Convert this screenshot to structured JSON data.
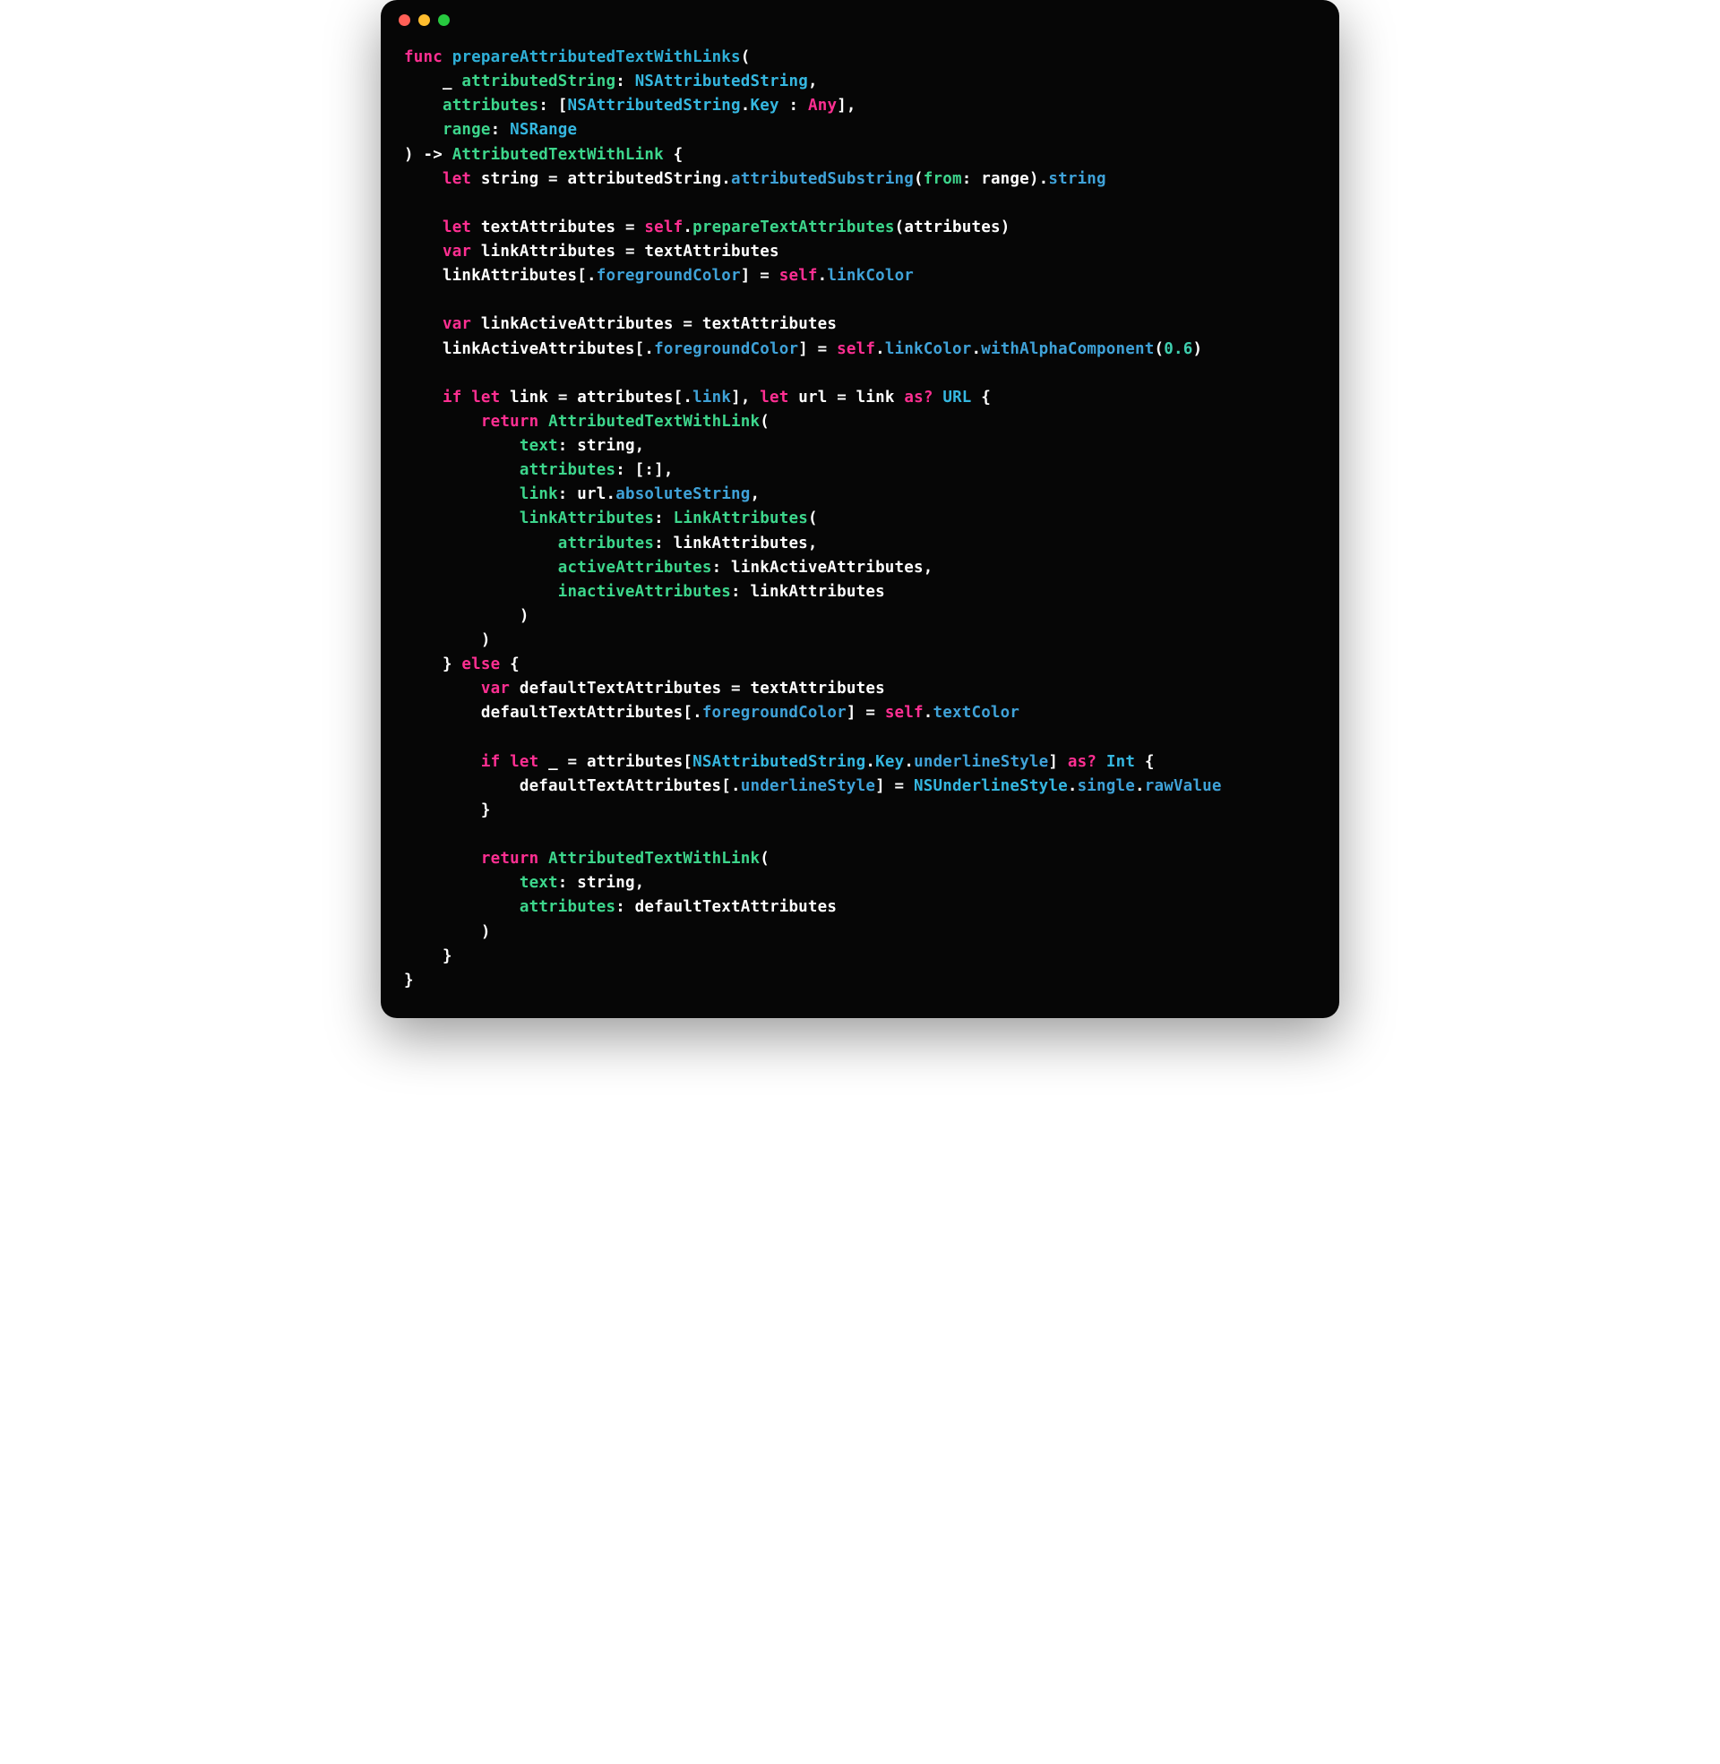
{
  "window": {
    "traffic_lights": {
      "close": "close",
      "minimize": "minimize",
      "zoom": "zoom"
    }
  },
  "code": {
    "l01": {
      "a": "func",
      "b": " ",
      "c": "prepareAttributedTextWithLinks",
      "d": "("
    },
    "l02": {
      "a": "    _ ",
      "b": "attributedString",
      "c": ": ",
      "d": "NSAttributedString",
      "e": ","
    },
    "l03": {
      "a": "    ",
      "b": "attributes",
      "c": ": [",
      "d": "NSAttributedString",
      "e": ".",
      "f": "Key",
      "g": " : ",
      "h": "Any",
      "i": "],"
    },
    "l04": {
      "a": "    ",
      "b": "range",
      "c": ": ",
      "d": "NSRange"
    },
    "l05": {
      "a": ") -> ",
      "b": "AttributedTextWithLink",
      "c": " {"
    },
    "l06": {
      "a": "    ",
      "b": "let",
      "c": " string = attributedString.",
      "d": "attributedSubstring",
      "e": "(",
      "f": "from",
      "g": ": range).",
      "h": "string"
    },
    "l07": "",
    "l08": {
      "a": "    ",
      "b": "let",
      "c": " textAttributes = ",
      "d": "self",
      "e": ".",
      "f": "prepareTextAttributes",
      "g": "(attributes)"
    },
    "l09": {
      "a": "    ",
      "b": "var",
      "c": " linkAttributes = textAttributes"
    },
    "l10": {
      "a": "    linkAttributes[.",
      "b": "foregroundColor",
      "c": "] = ",
      "d": "self",
      "e": ".",
      "f": "linkColor"
    },
    "l11": "",
    "l12": {
      "a": "    ",
      "b": "var",
      "c": " linkActiveAttributes = textAttributes"
    },
    "l13": {
      "a": "    linkActiveAttributes[.",
      "b": "foregroundColor",
      "c": "] = ",
      "d": "self",
      "e": ".",
      "f": "linkColor",
      "g": ".",
      "h": "withAlphaComponent",
      "i": "(",
      "j": "0.6",
      "k": ")"
    },
    "l14": "",
    "l15": {
      "a": "    ",
      "b": "if",
      "c": " ",
      "d": "let",
      "e": " link = attributes[.",
      "f": "link",
      "g": "], ",
      "h": "let",
      "i": " url = link ",
      "j": "as?",
      "k": " ",
      "l": "URL",
      "m": " {"
    },
    "l16": {
      "a": "        ",
      "b": "return",
      "c": " ",
      "d": "AttributedTextWithLink",
      "e": "("
    },
    "l17": {
      "a": "            ",
      "b": "text",
      "c": ": string,"
    },
    "l18": {
      "a": "            ",
      "b": "attributes",
      "c": ": [:],"
    },
    "l19": {
      "a": "            ",
      "b": "link",
      "c": ": url.",
      "d": "absoluteString",
      "e": ","
    },
    "l20": {
      "a": "            ",
      "b": "linkAttributes",
      "c": ": ",
      "d": "LinkAttributes",
      "e": "("
    },
    "l21": {
      "a": "                ",
      "b": "attributes",
      "c": ": linkAttributes,"
    },
    "l22": {
      "a": "                ",
      "b": "activeAttributes",
      "c": ": linkActiveAttributes,"
    },
    "l23": {
      "a": "                ",
      "b": "inactiveAttributes",
      "c": ": linkAttributes"
    },
    "l24": {
      "a": "            )"
    },
    "l25": {
      "a": "        )"
    },
    "l26": {
      "a": "    } ",
      "b": "else",
      "c": " {"
    },
    "l27": {
      "a": "        ",
      "b": "var",
      "c": " defaultTextAttributes = textAttributes"
    },
    "l28": {
      "a": "        defaultTextAttributes[.",
      "b": "foregroundColor",
      "c": "] = ",
      "d": "self",
      "e": ".",
      "f": "textColor"
    },
    "l29": "",
    "l30": {
      "a": "        ",
      "b": "if",
      "c": " ",
      "d": "let",
      "e": " _ = attributes[",
      "f": "NSAttributedString",
      "g": ".",
      "h": "Key",
      "i": ".",
      "j": "underlineStyle",
      "k": "] ",
      "l": "as?",
      "m": " ",
      "n": "Int",
      "o": " {"
    },
    "l31": {
      "a": "            defaultTextAttributes[.",
      "b": "underlineStyle",
      "c": "] = ",
      "d": "NSUnderlineStyle",
      "e": ".",
      "f": "single",
      "g": ".",
      "h": "rawValue"
    },
    "l32": {
      "a": "        }"
    },
    "l33": "",
    "l34": {
      "a": "        ",
      "b": "return",
      "c": " ",
      "d": "AttributedTextWithLink",
      "e": "("
    },
    "l35": {
      "a": "            ",
      "b": "text",
      "c": ": string,"
    },
    "l36": {
      "a": "            ",
      "b": "attributes",
      "c": ": defaultTextAttributes"
    },
    "l37": {
      "a": "        )"
    },
    "l38": {
      "a": "    }"
    },
    "l39": {
      "a": "}"
    }
  }
}
